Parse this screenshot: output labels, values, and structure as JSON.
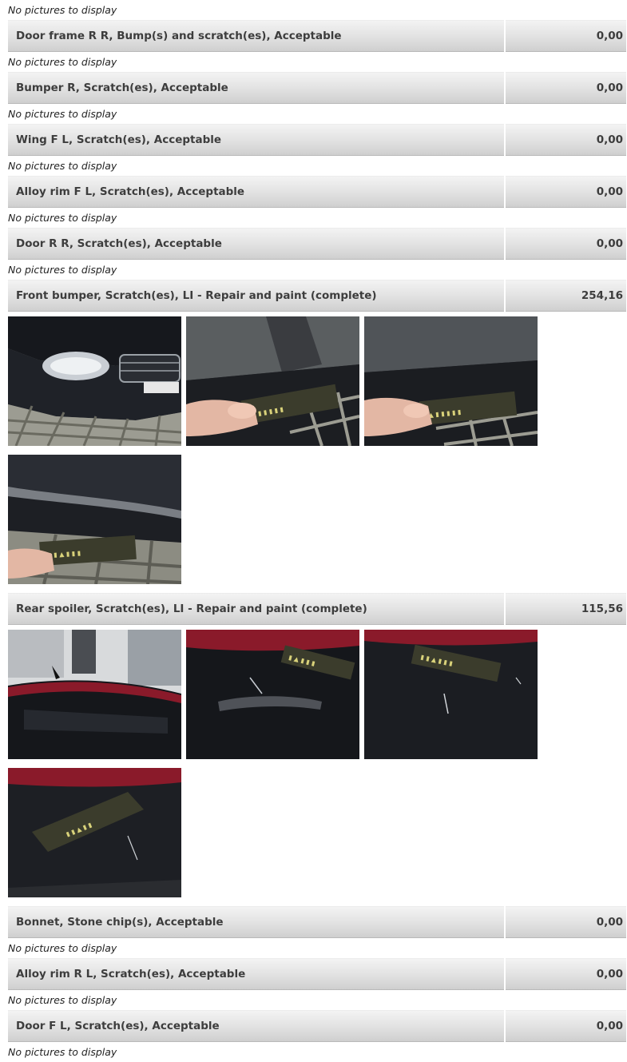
{
  "no_pictures_text": "No pictures to display",
  "items": [
    {
      "description": "Door frame R R, Bump(s) and scratch(es), Acceptable",
      "amount": "0,00",
      "photos": []
    },
    {
      "description": "Bumper R, Scratch(es), Acceptable",
      "amount": "0,00",
      "photos": []
    },
    {
      "description": "Wing F L, Scratch(es), Acceptable",
      "amount": "0,00",
      "photos": []
    },
    {
      "description": "Alloy rim F L, Scratch(es), Acceptable",
      "amount": "0,00",
      "photos": []
    },
    {
      "description": "Door R R, Scratch(es), Acceptable",
      "amount": "0,00",
      "photos": []
    },
    {
      "description": "Front bumper, Scratch(es), LI - Repair and paint (complete)",
      "amount": "254,16",
      "photos": [
        "front-bumper-photo-1",
        "front-bumper-photo-2",
        "front-bumper-photo-3",
        "front-bumper-photo-4"
      ]
    },
    {
      "description": "Rear spoiler, Scratch(es), LI - Repair and paint (complete)",
      "amount": "115,56",
      "photos": [
        "rear-spoiler-photo-1",
        "rear-spoiler-photo-2",
        "rear-spoiler-photo-3",
        "rear-spoiler-photo-4"
      ]
    },
    {
      "description": "Bonnet, Stone chip(s), Acceptable",
      "amount": "0,00",
      "photos": []
    },
    {
      "description": "Alloy rim R L, Scratch(es), Acceptable",
      "amount": "0,00",
      "photos": []
    },
    {
      "description": "Door F L, Scratch(es), Acceptable",
      "amount": "0,00",
      "photos": []
    }
  ],
  "colors": {
    "row_gradient_top": "#f3f3f3",
    "row_gradient_bottom": "#cfcfcf",
    "car_paint_black": "#1b1d22",
    "car_paint_red": "#8a1a2a",
    "paving_grey": "#9c9c92"
  }
}
